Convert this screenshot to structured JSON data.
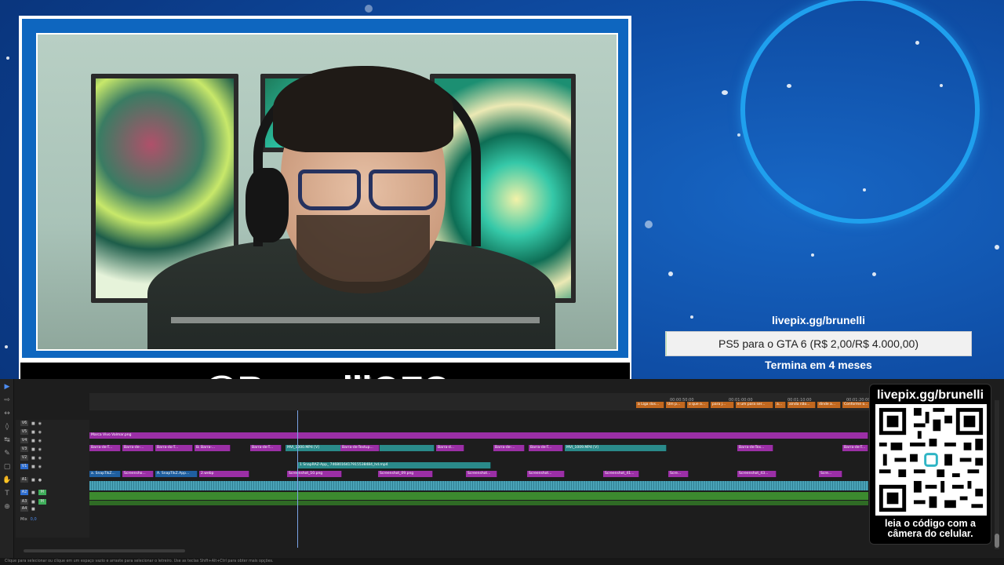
{
  "overlay": {
    "handle": "@BrunelliOFC",
    "goal": {
      "url": "livepix.gg/brunelli",
      "text": "PS5 para o GTA 6 (R$ 2,00/R$ 4.000,00)",
      "progress_fraction": 0.0005,
      "ends": "Termina em 4 meses"
    },
    "qr": {
      "url": "livepix.gg/brunelli",
      "caption_line1": "leia o código com a",
      "caption_line2": "câmera do celular."
    }
  },
  "colors": {
    "background": "#0f4ea6",
    "ring": "#1fa0ee",
    "frame": "#0e66bf",
    "clip_magenta": "#9b2fa6",
    "clip_teal": "#2a8a8a",
    "clip_orange": "#c2681f",
    "audio_green": "#3c8a2f"
  },
  "editor": {
    "timecodes": [
      "00:00:50:00",
      "00:01:00:00",
      "00:01:10:00",
      "00:01:20:00"
    ],
    "track_labels": [
      "V6",
      "V5",
      "V4",
      "V3",
      "V2",
      "V1",
      "A1",
      "A2",
      "A3",
      "A4",
      "Mix"
    ],
    "mix_value": "0,0",
    "clips_top": [
      "a Liga dos...",
      "Um p...",
      "o que o...",
      "para j...",
      "e um para ser...",
      "a...",
      "ainda não...",
      "dinde a...",
      "Conforme o..."
    ],
    "clip_v5": "Marca Vivo Valmar.png",
    "clips_v4": [
      "Barra-de-T...",
      "Barra-de-...",
      "Barra-do-T...",
      "Ba...",
      "Barra-...",
      "Barra-de-T...",
      "Barra-de-Textup...",
      "Barra-d...",
      "Barra-de-...",
      "Barra-de-T...",
      "Barra-de-Tex...",
      "Barra-de-T..."
    ],
    "clip_v4_main": "MVI_1000.MP4 [V]",
    "clip_v4_second": "MVI_1009.MP4 [V]",
    "clip_v2": "1 SnapRAZ-App_ 7468016417915538484_hd.mp4",
    "clips_v1": [
      "a. SnapTikZ...",
      "Screensho...",
      "A. SnapTikZ.App...",
      "2.webp",
      "Screenshot_10.png",
      "Screenshot_09.png",
      "Screenshot...",
      "Screenshot...",
      "Screenshot_41...",
      "Scre...",
      "Screenshot_43...",
      "Scre..."
    ],
    "status_text": "Clique para selecionar ou clique em um espaço vazio e arraste para selecionar o letreiro. Use as teclas Shift+Alt+Ctrl para obter mais opções."
  },
  "icons": [
    "selection-tool-icon",
    "track-select-icon",
    "ripple-edit-icon",
    "razor-icon",
    "slip-icon",
    "pen-icon",
    "rectangle-icon",
    "hand-icon",
    "type-icon",
    "lock-icon",
    "eye-icon",
    "mic-icon"
  ]
}
